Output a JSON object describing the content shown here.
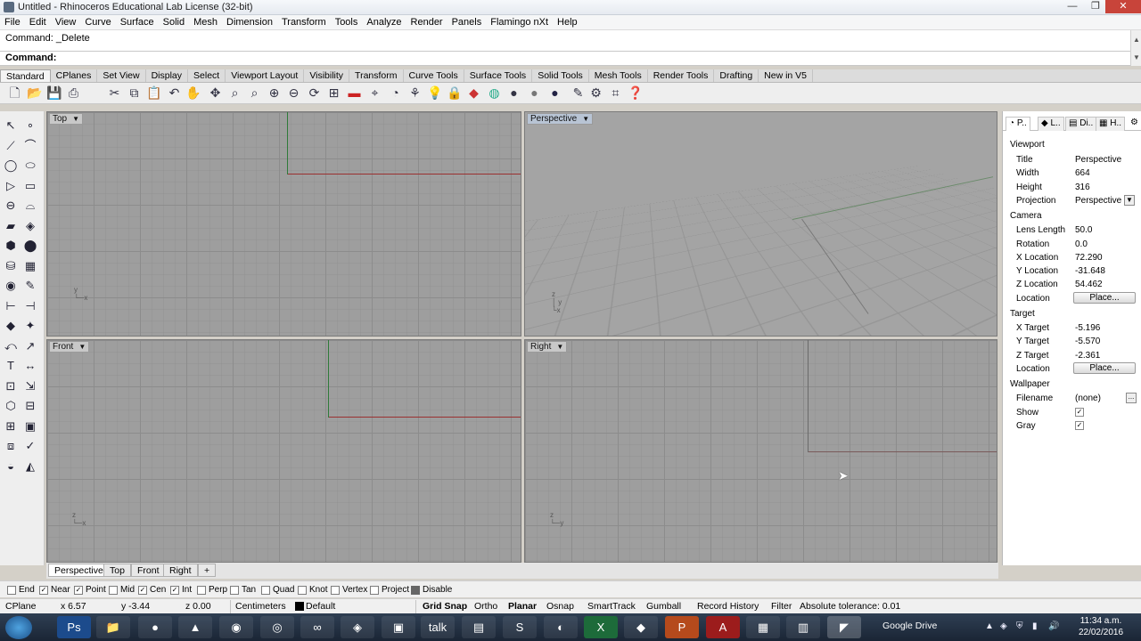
{
  "window": {
    "title": "Untitled - Rhinoceros Educational Lab License (32-bit)",
    "minimize": "—",
    "maximize": "❐",
    "close": "✕"
  },
  "menu": [
    "File",
    "Edit",
    "View",
    "Curve",
    "Surface",
    "Solid",
    "Mesh",
    "Dimension",
    "Transform",
    "Tools",
    "Analyze",
    "Render",
    "Panels",
    "Flamingo nXt",
    "Help"
  ],
  "command": {
    "history": "Command: _Delete",
    "prompt": "Command:"
  },
  "toolbar_tabs": [
    "Standard",
    "CPlanes",
    "Set View",
    "Display",
    "Select",
    "Viewport Layout",
    "Visibility",
    "Transform",
    "Curve Tools",
    "Surface Tools",
    "Solid Tools",
    "Mesh Tools",
    "Render Tools",
    "Drafting",
    "New in V5"
  ],
  "toolbar_icons": [
    "new-file-icon",
    "open-icon",
    "save-icon",
    "print-icon",
    "cut-icon",
    "copy-icon",
    "paste-icon",
    "undo-icon",
    "pan-icon",
    "move-icon",
    "zoom-icon",
    "zoom-window-icon",
    "zoom-extents-icon",
    "zoom-selected-icon",
    "rotate-view-icon",
    "four-view-icon",
    "cplane-icon",
    "named-view-icon",
    "properties-icon",
    "light-icon",
    "lock-icon",
    "layer-icon",
    "color-wheel-icon",
    "render-sphere-icon",
    "shaded-sphere-icon",
    "rendered-sphere-icon",
    "light-bulb-icon",
    "tools-icon",
    "snap-icon",
    "help-icon"
  ],
  "viewports": {
    "top": "Top",
    "perspective": "Perspective",
    "front": "Front",
    "right": "Right"
  },
  "viewport_tabs": [
    "Perspective",
    "Top",
    "Front",
    "Right"
  ],
  "viewport_tab_add": "+",
  "panel": {
    "tabs": [
      "P..",
      "L..",
      "Di..",
      "H.."
    ],
    "viewport_section": "Viewport",
    "title_key": "Title",
    "title_val": "Perspective",
    "width_key": "Width",
    "width_val": "664",
    "height_key": "Height",
    "height_val": "316",
    "projection_key": "Projection",
    "projection_val": "Perspective",
    "camera_section": "Camera",
    "lens_key": "Lens Length",
    "lens_val": "50.0",
    "rotation_key": "Rotation",
    "rotation_val": "0.0",
    "xloc_key": "X Location",
    "xloc_val": "72.290",
    "yloc_key": "Y Location",
    "yloc_val": "-31.648",
    "zloc_key": "Z Location",
    "zloc_val": "54.462",
    "location_key": "Location",
    "place_btn": "Place...",
    "target_section": "Target",
    "xt_key": "X Target",
    "xt_val": "-5.196",
    "yt_key": "Y Target",
    "yt_val": "-5.570",
    "zt_key": "Z Target",
    "zt_val": "-2.361",
    "tloc_key": "Location",
    "tplace_btn": "Place...",
    "wallpaper_section": "Wallpaper",
    "filename_key": "Filename",
    "filename_val": "(none)",
    "show_key": "Show",
    "gray_key": "Gray"
  },
  "osnaps": [
    {
      "label": "End",
      "checked": false
    },
    {
      "label": "Near",
      "checked": true
    },
    {
      "label": "Point",
      "checked": true
    },
    {
      "label": "Mid",
      "checked": false
    },
    {
      "label": "Cen",
      "checked": true
    },
    {
      "label": "Int",
      "checked": true
    },
    {
      "label": "Perp",
      "checked": false
    },
    {
      "label": "Tan",
      "checked": false
    },
    {
      "label": "Quad",
      "checked": false
    },
    {
      "label": "Knot",
      "checked": false
    },
    {
      "label": "Vertex",
      "checked": false
    },
    {
      "label": "Project",
      "checked": false
    },
    {
      "label": "Disable",
      "checked": false
    }
  ],
  "status": {
    "cplane": "CPlane",
    "x": "x 6.57",
    "y": "y -3.44",
    "z": "z 0.00",
    "units": "Centimeters",
    "layer": "Default",
    "grid_snap": "Grid Snap",
    "ortho": "Ortho",
    "planar": "Planar",
    "osnap": "Osnap",
    "smarttrack": "SmartTrack",
    "gumball": "Gumball",
    "record_history": "Record History",
    "filter": "Filter",
    "tolerance": "Absolute tolerance: 0.01"
  },
  "taskbar": {
    "apps": [
      "Ps",
      "📁",
      "●",
      "▲",
      "◉",
      "◎",
      "∞",
      "◈",
      "▣",
      "talk",
      "▤",
      "S",
      "◐",
      "X",
      "◆",
      "P",
      "A",
      "▦",
      "▥",
      "◤"
    ],
    "gdrive": "Google Drive",
    "time": "11:34 a.m.",
    "date": "22/02/2016"
  }
}
